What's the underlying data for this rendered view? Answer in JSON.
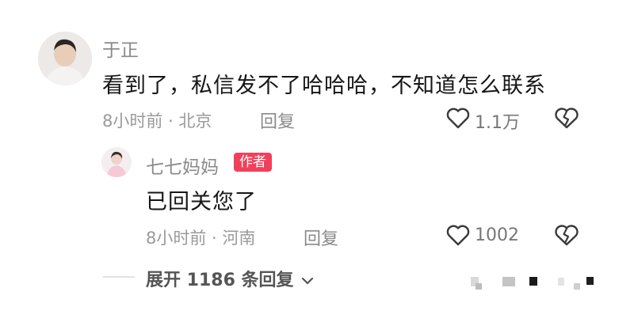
{
  "comment": {
    "username": "于正",
    "text": "看到了，私信发不了哈哈哈，不知道怎么联系",
    "meta": "8小时前 · 北京",
    "reply_label": "回复",
    "like_count": "1.1万"
  },
  "reply": {
    "username": "七七妈妈",
    "badge": "作者",
    "text": "已回关您了",
    "meta": "8小时前 · 河南",
    "reply_label": "回复",
    "like_count": "1002"
  },
  "expand_label": "展开 1186 条回复",
  "colors": {
    "badge": "#f2405b",
    "text": "#161616",
    "muted": "#8a8a8a"
  }
}
